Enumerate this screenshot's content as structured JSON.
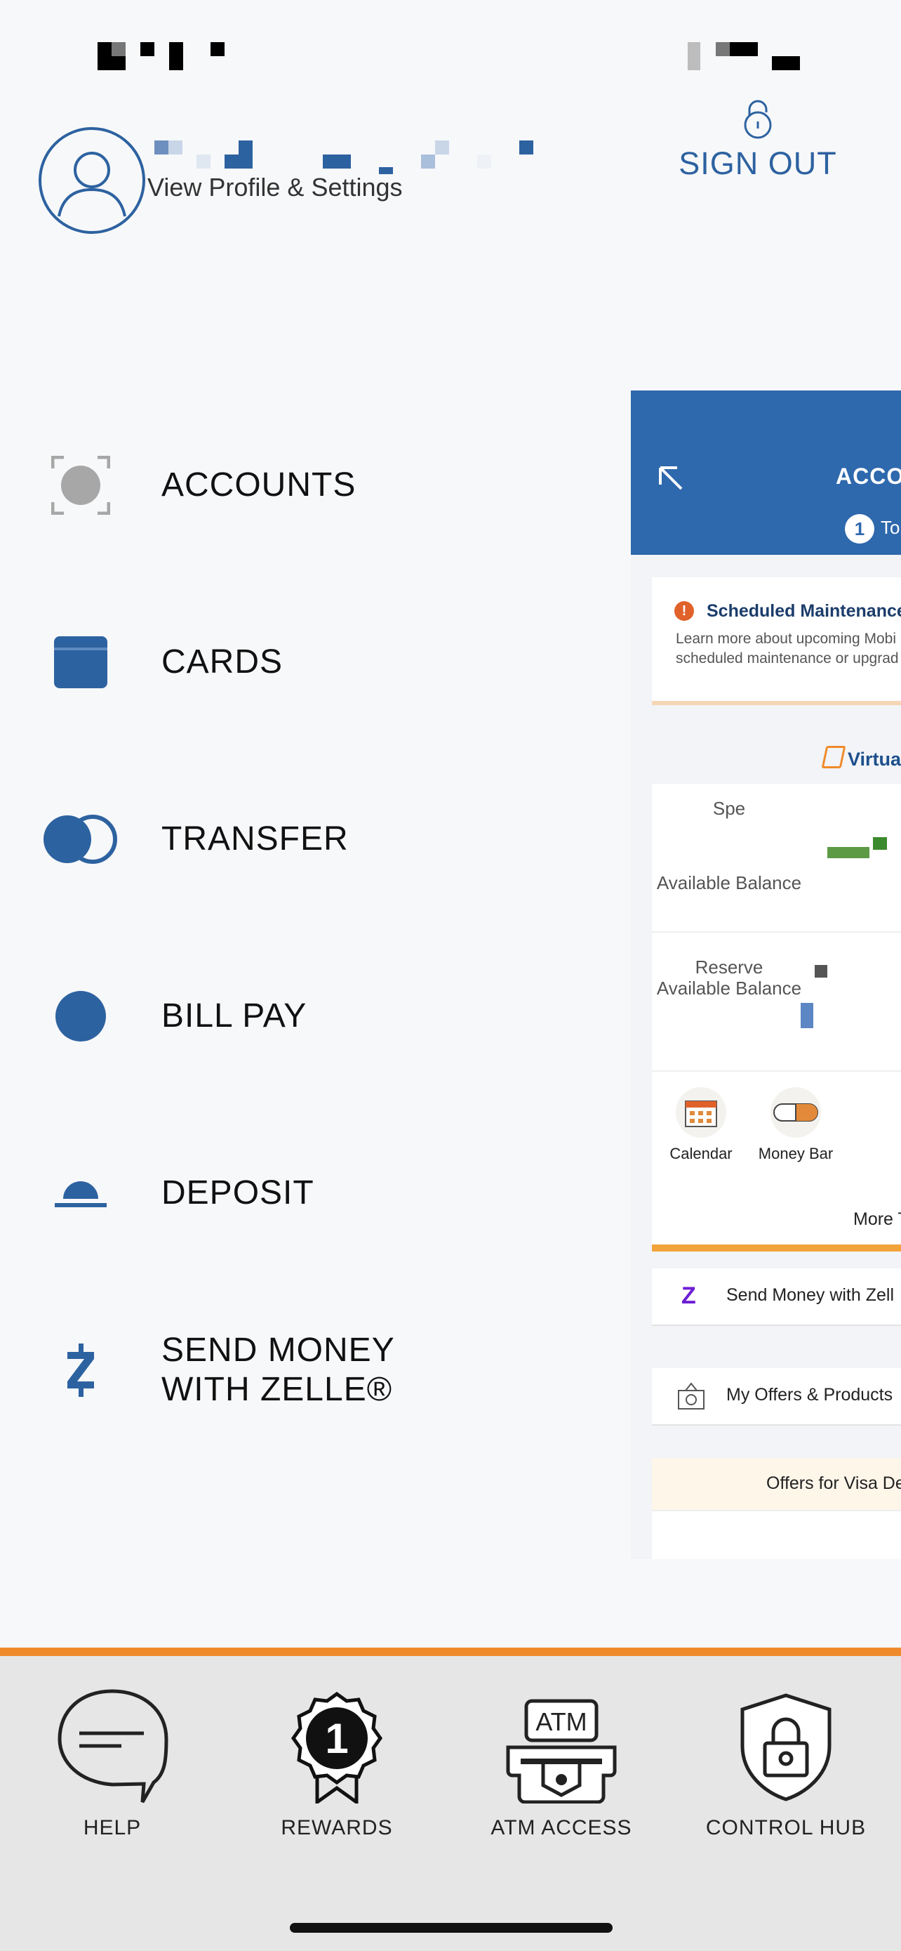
{
  "header": {
    "view_profile": "View Profile & Settings",
    "sign_out": "SIGN OUT"
  },
  "menu": [
    {
      "label": "ACCOUNTS",
      "icon": "accounts-icon"
    },
    {
      "label": "CARDS",
      "icon": "card-icon"
    },
    {
      "label": "TRANSFER",
      "icon": "transfer-icon"
    },
    {
      "label": "BILL PAY",
      "icon": "bill-pay-icon"
    },
    {
      "label": "DEPOSIT",
      "icon": "deposit-icon"
    },
    {
      "label_line1": "SEND MONEY",
      "label_line2": "WITH ZELLE®",
      "icon": "zelle-icon"
    }
  ],
  "preview": {
    "title": "ACCO",
    "badge": "1",
    "badge_text": "To",
    "maintenance_title": "Scheduled Maintenance",
    "maintenance_line1": "Learn more about upcoming Mobi",
    "maintenance_line2": "scheduled maintenance or upgrad",
    "virtual": "Virtua",
    "spend_label": "Spe",
    "available_balance_1": "Available Balance",
    "reserve_label": "Reserve",
    "available_balance_2": "Available Balance",
    "quick_actions": [
      "Calendar",
      "Money Bar"
    ],
    "more": "More T",
    "send_money": "Send Money with Zell",
    "my_offers": "My Offers & Products",
    "offers_visa": "Offers for Visa De"
  },
  "bottom_tabs": [
    {
      "label": "HELP",
      "icon": "help-chat-icon"
    },
    {
      "label": "REWARDS",
      "icon": "rewards-badge-icon"
    },
    {
      "label": "ATM ACCESS",
      "icon": "atm-icon"
    },
    {
      "label": "CONTROL HUB",
      "icon": "shield-lock-icon"
    }
  ],
  "colors": {
    "brand_blue": "#2d62a0",
    "accent_orange": "#ef8a2a",
    "background": "#f7f8fa"
  }
}
